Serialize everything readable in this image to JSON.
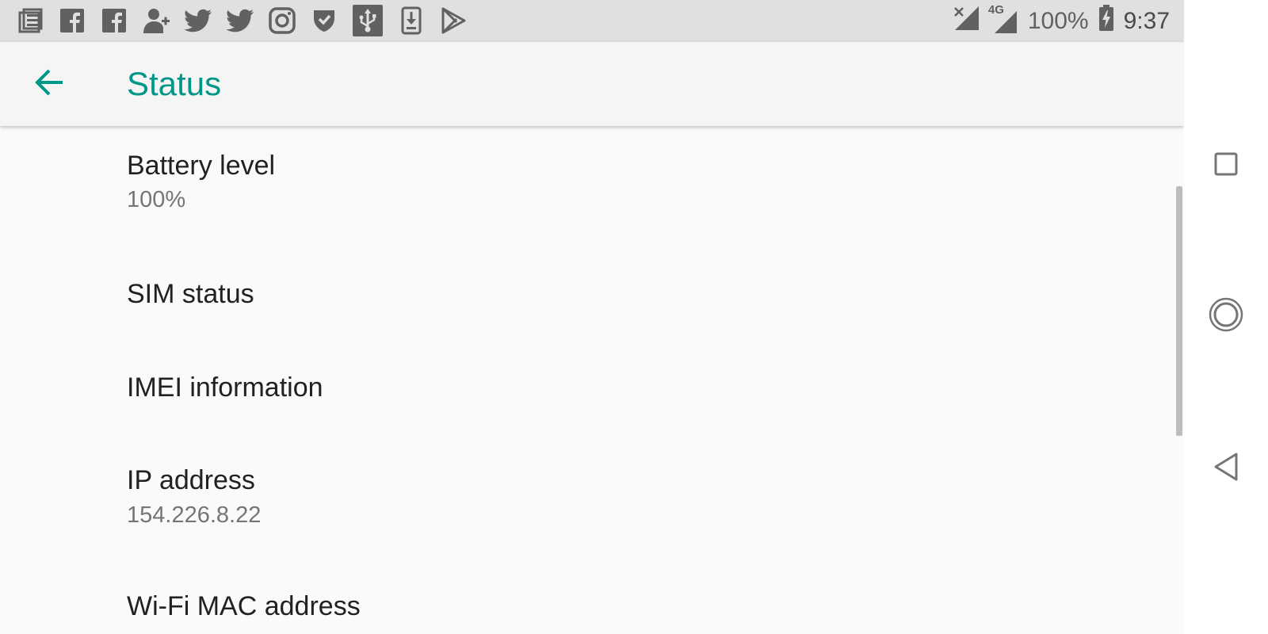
{
  "status_bar": {
    "notification_icons": [
      "news-icon",
      "facebook-icon",
      "facebook-icon",
      "add-contact-icon",
      "twitter-icon",
      "twitter-icon",
      "instagram-icon",
      "shield-check-icon",
      "usb-icon",
      "download-icon",
      "play-store-icon"
    ],
    "battery_percent": "100%",
    "time": "9:37",
    "network_label": "4G"
  },
  "app_bar": {
    "title": "Status"
  },
  "items": [
    {
      "title": "Battery level",
      "summary": "100%"
    },
    {
      "title": "SIM status",
      "summary": ""
    },
    {
      "title": "IMEI information",
      "summary": ""
    },
    {
      "title": "IP address",
      "summary": "154.226.8.22"
    },
    {
      "title": "Wi-Fi MAC address",
      "summary": ""
    }
  ],
  "colors": {
    "accent": "#009688",
    "status_bar_bg": "#e0e0e0",
    "app_bar_bg": "#f5f5f5",
    "background": "#fafafa",
    "primary_text": "#212121",
    "secondary_text": "#757575"
  }
}
